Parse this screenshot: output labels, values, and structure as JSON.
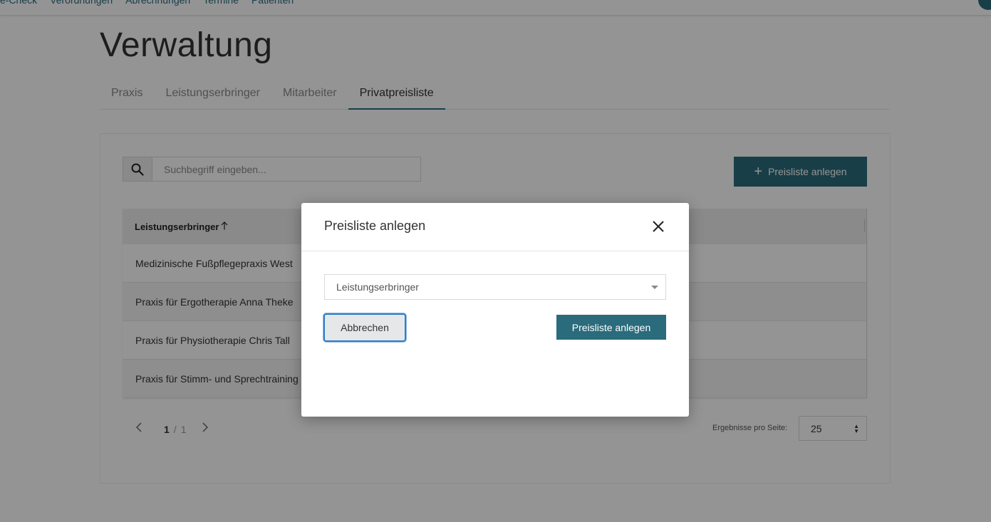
{
  "topnav": {
    "items": [
      "e-Check",
      "Verordnungen",
      "Abrechnungen",
      "Termine",
      "Patienten"
    ]
  },
  "page": {
    "title": "Verwaltung"
  },
  "tabs": [
    {
      "label": "Praxis",
      "active": false
    },
    {
      "label": "Leistungserbringer",
      "active": false
    },
    {
      "label": "Mitarbeiter",
      "active": false
    },
    {
      "label": "Privatpreisliste",
      "active": true
    }
  ],
  "search": {
    "placeholder": "Suchbegriff eingeben...",
    "value": ""
  },
  "toolbar": {
    "create_label": "Preisliste anlegen"
  },
  "table": {
    "header": "Leistungserbringer",
    "sort_icon": "arrow-up-icon",
    "rows": [
      "Medizinische Fußpflegepraxis West",
      "Praxis für Ergotherapie Anna Theke",
      "Praxis für Physiotherapie Chris Tall",
      "Praxis für Stimm- und Sprechtraining Peter Sil"
    ]
  },
  "pagination": {
    "current": "1",
    "separator": "/",
    "total": "1",
    "per_page_label": "Ergebnisse pro Seite:",
    "per_page_value": "25"
  },
  "modal": {
    "title": "Preisliste anlegen",
    "select_placeholder": "Leistungserbringer",
    "cancel_label": "Abbrechen",
    "submit_label": "Preisliste anlegen"
  },
  "colors": {
    "primary": "#2a6b7c",
    "focus_ring": "#2d7fc8"
  }
}
